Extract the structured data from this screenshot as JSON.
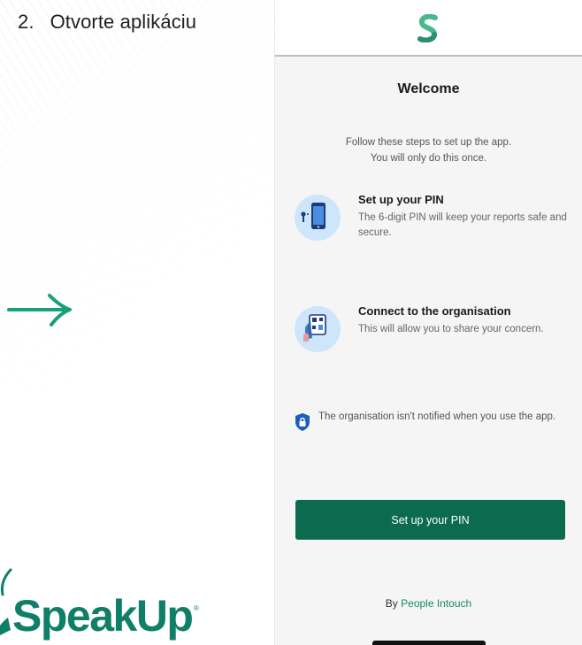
{
  "slide": {
    "step_number": "2.",
    "step_title": "Otvorte aplikáciu",
    "arrow_icon": "arrow-right-icon",
    "brand": {
      "wordmark": "SpeakUp",
      "registered_mark": "®",
      "color": "#0f7f68"
    }
  },
  "app": {
    "logo_icon": "speakup-s-logo-icon",
    "title": "Welcome",
    "intro_line1": "Follow these steps to set up the app.",
    "intro_line2": "You will only do this once.",
    "steps": [
      {
        "icon": "phone-pin-icon",
        "title": "Set up your PIN",
        "description": "The 6-digit PIN will keep your reports safe and secure."
      },
      {
        "icon": "qr-scan-icon",
        "title": "Connect to the organisation",
        "description": "This will allow you to share your concern."
      }
    ],
    "notice": {
      "icon": "shield-lock-icon",
      "text": "The organisation isn't notified when you use the app."
    },
    "cta_label": "Set up your PIN",
    "byline_prefix": "By",
    "byline_link": "People Intouch",
    "colors": {
      "primary": "#0c6b4f",
      "link": "#168a66",
      "icon_bg": "#cde6fb",
      "screen_bg": "#f5f5f5"
    }
  }
}
